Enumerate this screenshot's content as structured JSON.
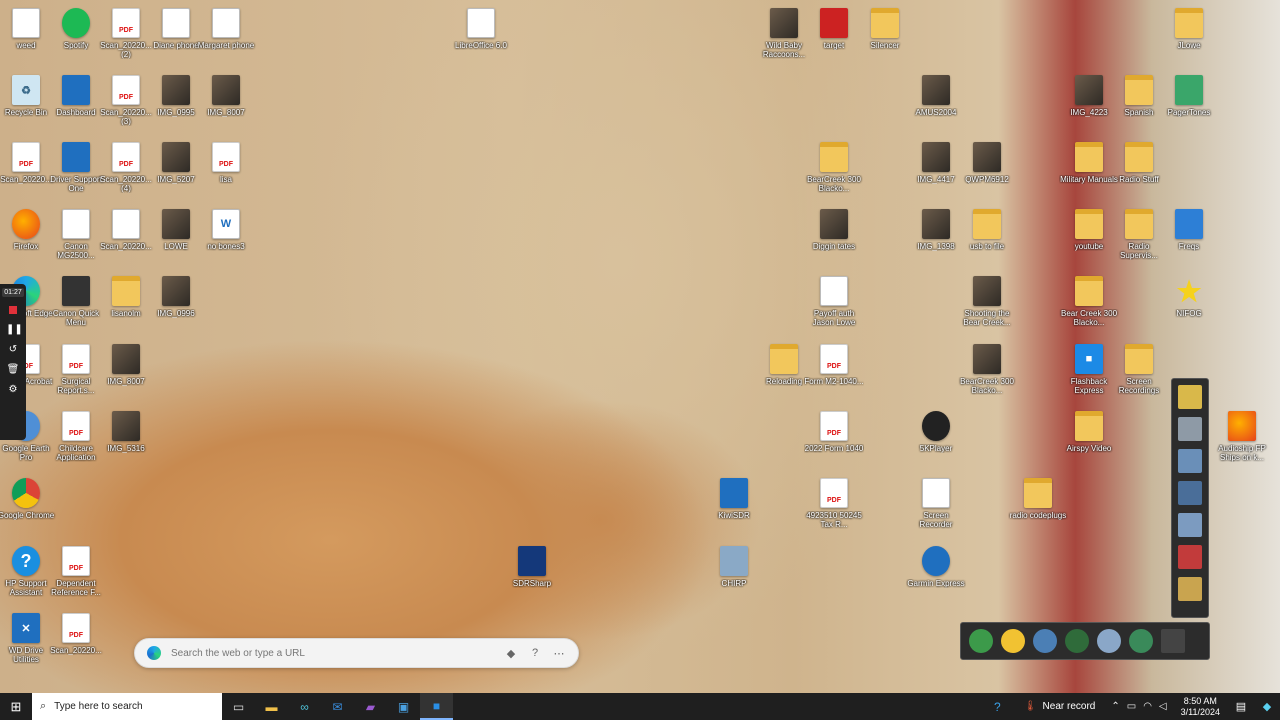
{
  "desktop": {
    "icons": [
      {
        "label": "weed",
        "glyph": "doc"
      },
      {
        "label": "Spotify",
        "glyph": "spotify"
      },
      {
        "label": "Scan_20220... (2)",
        "glyph": "pdf"
      },
      {
        "label": "Diane phone",
        "glyph": "doc"
      },
      {
        "label": "Margaret phone",
        "glyph": "doc"
      },
      {
        "label": "LibreOffice 6.0",
        "glyph": "doc"
      },
      {
        "label": "Wild Baby Raccoons...",
        "glyph": "img"
      },
      {
        "label": "target",
        "glyph": "img"
      },
      {
        "label": "Silencer",
        "glyph": "folder"
      },
      {
        "label": "JLowe",
        "glyph": "folder"
      },
      {
        "label": "Recycle Bin",
        "glyph": "bin"
      },
      {
        "label": "Dashboard",
        "glyph": "app"
      },
      {
        "label": "Scan_20220... (3)",
        "glyph": "pdf"
      },
      {
        "label": "IMG_0995",
        "glyph": "img"
      },
      {
        "label": "IMG_8007",
        "glyph": "img"
      },
      {
        "label": "AMUS2004",
        "glyph": "img"
      },
      {
        "label": "IMG_4223",
        "glyph": "img"
      },
      {
        "label": "Spanish",
        "glyph": "folder"
      },
      {
        "label": "PagerTones",
        "glyph": "app"
      },
      {
        "label": "Scan_20220...",
        "glyph": "pdf"
      },
      {
        "label": "Driver Support One",
        "glyph": "app"
      },
      {
        "label": "Scan_20220... (4)",
        "glyph": "pdf"
      },
      {
        "label": "IMG_5207",
        "glyph": "img"
      },
      {
        "label": "lisa",
        "glyph": "pdf"
      },
      {
        "label": "BearCreek 300 Blacko...",
        "glyph": "folder"
      },
      {
        "label": "IMG_4417",
        "glyph": "img"
      },
      {
        "label": "QWPM6912",
        "glyph": "img"
      },
      {
        "label": "Military Manuals",
        "glyph": "folder"
      },
      {
        "label": "Radio Stuff",
        "glyph": "folder"
      },
      {
        "label": "Firefox",
        "glyph": "firefox"
      },
      {
        "label": "Canon MG2500...",
        "glyph": "app"
      },
      {
        "label": "Scan_20220...",
        "glyph": "doc"
      },
      {
        "label": "LOWE",
        "glyph": "img"
      },
      {
        "label": "no bones3",
        "glyph": "doc"
      },
      {
        "label": "Diggin tates",
        "glyph": "img"
      },
      {
        "label": "IMG_1398",
        "glyph": "img"
      },
      {
        "label": "usb to file",
        "glyph": "folder"
      },
      {
        "label": "youtube",
        "glyph": "folder"
      },
      {
        "label": "Radio Supervis...",
        "glyph": "folder"
      },
      {
        "label": "Freqs",
        "glyph": "app"
      },
      {
        "label": "Microsoft Edge",
        "glyph": "app"
      },
      {
        "label": "Canon Quick Menu",
        "glyph": "app"
      },
      {
        "label": "lisanolm",
        "glyph": "folder"
      },
      {
        "label": "IMG_0996",
        "glyph": "img"
      },
      {
        "label": "Payoff auth Jason Lowe",
        "glyph": "doc"
      },
      {
        "label": "Shooting the Bear Creek...",
        "glyph": "img"
      },
      {
        "label": "Bear Creek 300 Blacko...",
        "glyph": "folder"
      },
      {
        "label": "NIFOG",
        "glyph": "star"
      },
      {
        "label": "Adobe Acrobat",
        "glyph": "pdf"
      },
      {
        "label": "Surgical Report.s...",
        "glyph": "pdf"
      },
      {
        "label": "IMG_8007",
        "glyph": "img"
      },
      {
        "label": "Reloading",
        "glyph": "folder"
      },
      {
        "label": "Form M2-1040...",
        "glyph": "pdf"
      },
      {
        "label": "BearCreek 300 Blacko...",
        "glyph": "img"
      },
      {
        "label": "Flashback Express",
        "glyph": "video"
      },
      {
        "label": "Screen Recordings",
        "glyph": "folder"
      },
      {
        "label": "Google Earth Pro",
        "glyph": "app"
      },
      {
        "label": "Childcare Application",
        "glyph": "pdf"
      },
      {
        "label": "IMG_5316",
        "glyph": "img"
      },
      {
        "label": "2022 Form 1040",
        "glyph": "pdf"
      },
      {
        "label": "5KPlayer",
        "glyph": "app"
      },
      {
        "label": "Airspy Video",
        "glyph": "folder"
      },
      {
        "label": "Audioship FP Ships on k...",
        "glyph": "firefox"
      },
      {
        "label": "Google Chrome",
        "glyph": "chrome"
      },
      {
        "label": "KiwiSDR",
        "glyph": "app"
      },
      {
        "label": "4923510 50245 Tax R...",
        "glyph": "pdf"
      },
      {
        "label": "Screen Recorder",
        "glyph": "doc"
      },
      {
        "label": "radio codeplugs",
        "glyph": "folder"
      },
      {
        "label": "HP Support Assistant",
        "glyph": "help"
      },
      {
        "label": "Dependent Reference F...",
        "glyph": "pdf"
      },
      {
        "label": "SDRSharp",
        "glyph": "app"
      },
      {
        "label": "CHIRP",
        "glyph": "app"
      },
      {
        "label": "Garmin Express",
        "glyph": "app"
      },
      {
        "label": "WD Drive Utilities",
        "glyph": "wd"
      },
      {
        "label": "Scan_20220...",
        "glyph": "pdf"
      }
    ]
  },
  "recorder": {
    "time": "01:27"
  },
  "browser_search": {
    "placeholder": "Search the web or type a URL"
  },
  "taskbar": {
    "search_placeholder": "Type here to search",
    "weather_text": "Near record",
    "time": "8:50 AM",
    "date": "3/11/2024"
  },
  "colors": {
    "taskbar": "#1f1f1f",
    "accent": "#1c6fd0"
  }
}
